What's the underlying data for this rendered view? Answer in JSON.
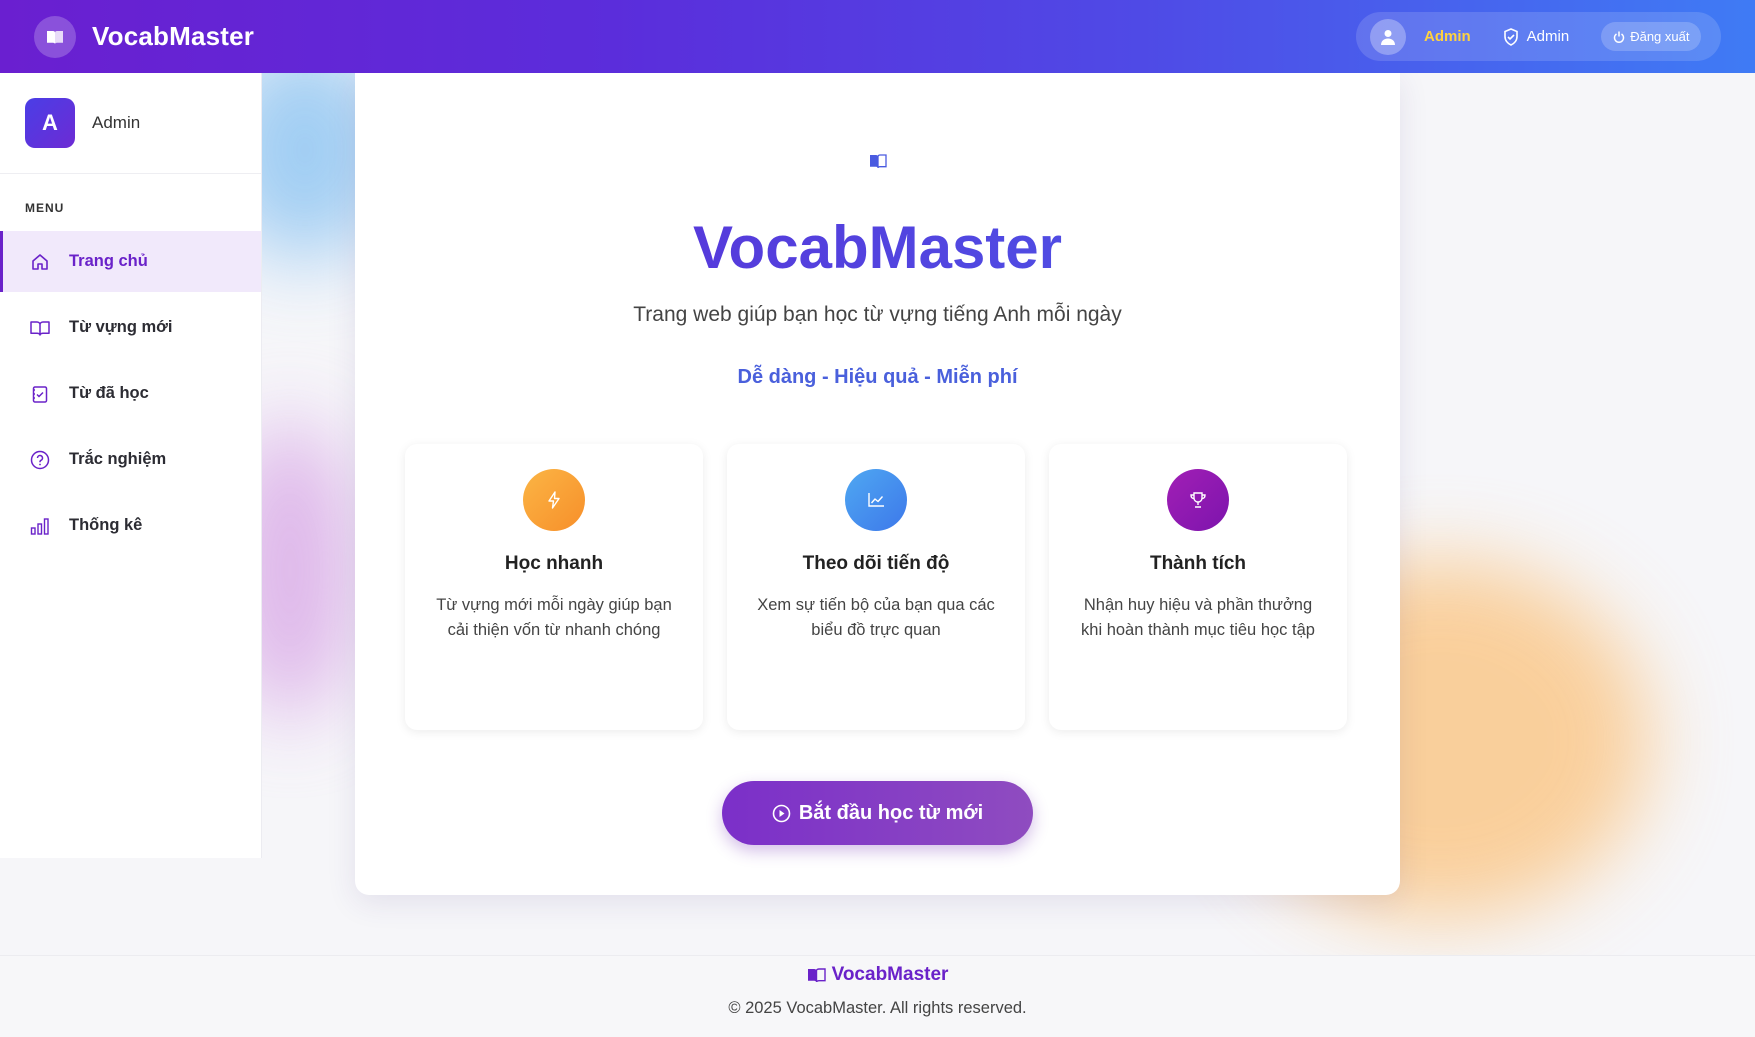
{
  "header": {
    "brand": "VocabMaster",
    "username": "Admin",
    "role": "Admin",
    "logout_label": "Đăng xuất"
  },
  "sidebar": {
    "avatar_letter": "A",
    "username": "Admin",
    "menu_label": "MENU",
    "items": [
      {
        "label": "Trang chủ",
        "icon": "home-icon",
        "active": true
      },
      {
        "label": "Từ vựng mới",
        "icon": "book-icon",
        "active": false
      },
      {
        "label": "Từ đã học",
        "icon": "checklist-icon",
        "active": false
      },
      {
        "label": "Trắc nghiệm",
        "icon": "question-icon",
        "active": false
      },
      {
        "label": "Thống kê",
        "icon": "bar-chart-icon",
        "active": false
      }
    ]
  },
  "hero": {
    "title": "VocabMaster",
    "subtitle": "Trang web giúp bạn học từ vựng tiếng Anh mỗi ngày",
    "tagline": "Dễ dàng - Hiệu quả - Miễn phí"
  },
  "features": [
    {
      "title": "Học nhanh",
      "desc": "Từ vựng mới mỗi ngày giúp bạn cải thiện vốn từ nhanh chóng",
      "icon": "bolt-icon",
      "color": "#f9a23a"
    },
    {
      "title": "Theo dõi tiến độ",
      "desc": "Xem sự tiến bộ của bạn qua các biểu đồ trực quan",
      "icon": "chart-line-icon",
      "color": "#3f8ff0"
    },
    {
      "title": "Thành tích",
      "desc": "Nhận huy hiệu và phần thưởng khi hoàn thành mục tiêu học tập",
      "icon": "trophy-icon",
      "color": "#8e16b0"
    }
  ],
  "cta": {
    "label": "Bắt đầu học từ mới"
  },
  "footer": {
    "brand": "VocabMaster",
    "copyright": "© 2025 VocabMaster. All rights reserved."
  },
  "colors": {
    "accent": "#6a22c9",
    "header_start": "#6a1fd0",
    "header_end": "#3f7bf5",
    "highlight_user": "#ffd23f"
  }
}
